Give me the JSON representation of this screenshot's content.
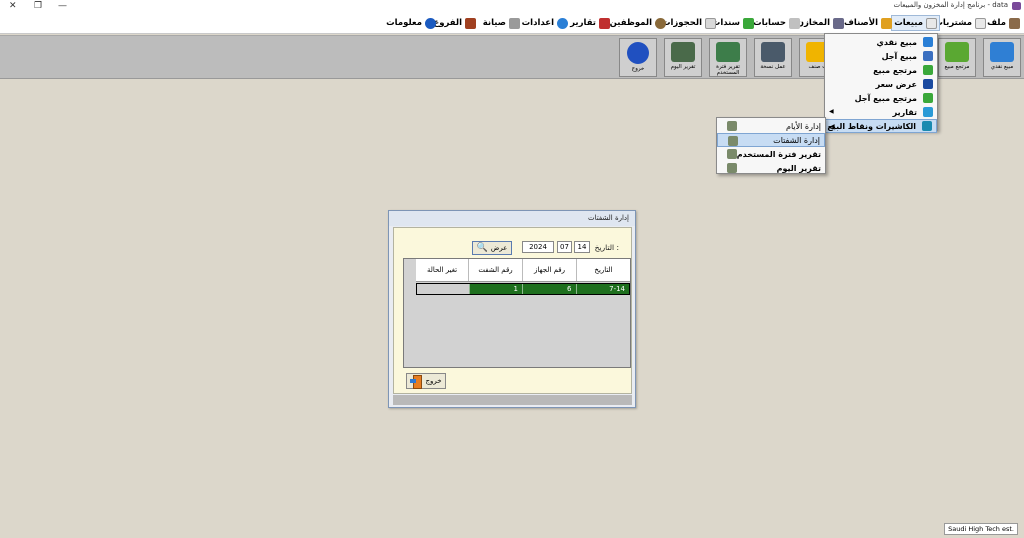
{
  "window": {
    "title": "data - برنامج إدارة المخزون والمبيعات",
    "minimize": "—",
    "restore": "❐",
    "close": "✕"
  },
  "menu": {
    "items": [
      {
        "label": "ملف",
        "icon": "tools-icon"
      },
      {
        "label": "مشتريات",
        "icon": "document-icon"
      },
      {
        "label": "مبيعات",
        "icon": "document-icon",
        "active": true
      },
      {
        "label": "الأصناف",
        "icon": "box-icon"
      },
      {
        "label": "المخازن",
        "icon": "warehouse-icon"
      },
      {
        "label": "حسابات",
        "icon": "calculator-icon"
      },
      {
        "label": "سندات",
        "icon": "receipt-icon"
      },
      {
        "label": "الحجوزات",
        "icon": "reservation-icon"
      },
      {
        "label": "الموظفين",
        "icon": "employee-icon"
      },
      {
        "label": "تقارير",
        "icon": "report-icon"
      },
      {
        "label": "اعدادات",
        "icon": "settings-icon"
      },
      {
        "label": "صيانة",
        "icon": "maintenance-icon"
      },
      {
        "label": "الفروع",
        "icon": "branches-icon"
      },
      {
        "label": "معلومات",
        "icon": "info-icon"
      }
    ]
  },
  "toolbar": {
    "buttons": [
      {
        "label": "مبيع نقدي",
        "color": "#2f7fd4"
      },
      {
        "label": "مرتجع مبيع",
        "color": "#5aa832"
      },
      {
        "label": "ت صنف",
        "color": "#f0b400"
      },
      {
        "label": "عمل نسخة",
        "color": "#4a5a6a"
      },
      {
        "label": "تقرير فترة المستخدم",
        "color": "#3d7d4a"
      },
      {
        "label": "تقرير اليوم",
        "color": "#4a6a4a"
      },
      {
        "label": "خروج",
        "color": "#2050c0"
      }
    ]
  },
  "sales_menu": {
    "items": [
      {
        "label": "مبيع نقدي",
        "color": "#2a7fd6"
      },
      {
        "label": "مبيع آجل",
        "color": "#3a6fc0"
      },
      {
        "label": "مرتجع مبيع",
        "color": "#3aa83a"
      },
      {
        "label": "عرض سعر",
        "color": "#1a4aa0"
      },
      {
        "label": "مرتجع مبيع آجل",
        "color": "#3aa83a"
      },
      {
        "label": "تقارير",
        "color": "#2a9ad6",
        "submenu": true
      },
      {
        "label": "الكاشيرات ونقاط البيع",
        "color": "#1a8ab0",
        "submenu": true,
        "selected": true
      }
    ]
  },
  "cashier_submenu": {
    "items": [
      {
        "label": "إدارة الأيام"
      },
      {
        "label": "إدارة الشفتات",
        "selected": true
      },
      {
        "label": "تقرير فترة المستخدم"
      },
      {
        "label": "تقرير اليوم"
      }
    ]
  },
  "dialog": {
    "title": "إدارة الشفتات",
    "date_label": "التاريخ :",
    "day": "14",
    "month": "07",
    "year": "2024",
    "show_button": "عرض",
    "columns": [
      "التاريخ",
      "رقم الجهاز",
      "رقم الشفت",
      "تغير الحالة"
    ],
    "rows": [
      {
        "date": "7-14",
        "device": "6",
        "shift": "1",
        "status": ""
      }
    ],
    "exit_button": "خروج"
  },
  "footer": {
    "company": "Saudi High Tech est."
  }
}
